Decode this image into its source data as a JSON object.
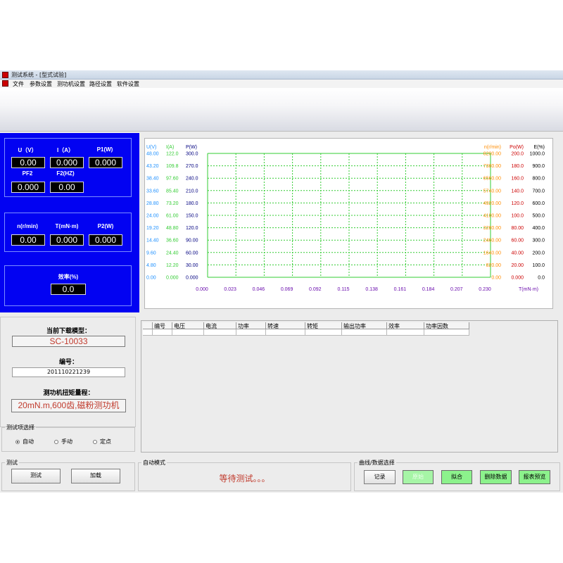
{
  "window": {
    "title": "测试系统 - [型式试验]",
    "menu": [
      "文件",
      "参数设置",
      "测功机设置",
      "路径设置",
      "软件设置"
    ]
  },
  "readings": {
    "u_label": "U（V）",
    "u_value": "0.00",
    "i_label": "I（A）",
    "i_value": "0.000",
    "p1_label": "P1(W)",
    "p1_value": "0.000",
    "pf2_label": "PF2",
    "pf2_value": "0.000",
    "f2_label": "F2(HZ)",
    "f2_value": "0.00",
    "n_label": "n(r/min)",
    "n_value": "0.00",
    "t_label": "T(mN·m)",
    "t_value": "0.000",
    "p2_label": "P2(W)",
    "p2_value": "0.000",
    "eff_label": "效率(%)",
    "eff_value": "0.0"
  },
  "chart_data": {
    "type": "line",
    "x": [],
    "series": [],
    "xlabel": "T(mN·m)",
    "x_ticks": [
      "0.000",
      "0.023",
      "0.046",
      "0.069",
      "0.092",
      "0.115",
      "0.138",
      "0.161",
      "0.184",
      "0.207",
      "0.230"
    ],
    "xlim": [
      0,
      0.23
    ],
    "grid": true,
    "colors": {
      "u": "#1e90ff",
      "i": "#33cc33",
      "p": "#000080",
      "n": "#ff8c00",
      "po": "#cc0000",
      "eff": "#000000",
      "grid": "#33cc33"
    },
    "left_axes": [
      {
        "label": "U(V)",
        "color": "#1e90ff",
        "ylim": [
          0,
          48
        ],
        "ticks": [
          "0.00",
          "4.80",
          "9.60",
          "14.40",
          "19.20",
          "24.00",
          "28.80",
          "33.60",
          "38.40",
          "43.20",
          "48.00"
        ]
      },
      {
        "label": "I(A)",
        "color": "#33cc33",
        "ylim": [
          0,
          122
        ],
        "ticks": [
          "0.000",
          "12.20",
          "24.40",
          "36.60",
          "48.80",
          "61.00",
          "73.20",
          "85.40",
          "97.60",
          "109.8",
          "122.0"
        ]
      },
      {
        "label": "P(W)",
        "color": "#000080",
        "ylim": [
          0,
          300
        ],
        "ticks": [
          "0.000",
          "30.00",
          "60.00",
          "90.00",
          "120.0",
          "150.0",
          "180.0",
          "210.0",
          "240.0",
          "270.0",
          "300.0"
        ]
      }
    ],
    "right_axes": [
      {
        "label": "n(r/min)",
        "color": "#ff8c00",
        "ylim": [
          0,
          8200
        ],
        "ticks": [
          "0.00",
          "820.00",
          "1640.00",
          "2460.00",
          "3280.00",
          "4100.00",
          "4920.00",
          "5740.00",
          "6560.00",
          "7380.00",
          "8200.00"
        ]
      },
      {
        "label": "Po(W)",
        "color": "#cc0000",
        "ylim": [
          0,
          200
        ],
        "ticks": [
          "0.000",
          "20.00",
          "40.00",
          "60.00",
          "80.00",
          "100.0",
          "120.0",
          "140.0",
          "160.0",
          "180.0",
          "200.0"
        ]
      },
      {
        "label": "E(%)",
        "color": "#000000",
        "ylim": [
          0,
          1000
        ],
        "ticks": [
          "0.0",
          "100.0",
          "200.0",
          "300.0",
          "400.0",
          "500.0",
          "600.0",
          "700.0",
          "800.0",
          "900.0",
          "1000.0"
        ]
      }
    ]
  },
  "model": {
    "current_label": "当前下载模型：",
    "current_value": "SC-10033",
    "id_label": "编号：",
    "id_value": "201110221239",
    "range_label": "测功机扭矩量程：",
    "range_value": "20mN.m,600齿,磁粉测功机"
  },
  "test_item": {
    "legend": "测试项选择",
    "options": [
      {
        "label": "自动",
        "selected": true
      },
      {
        "label": "手动",
        "selected": false
      },
      {
        "label": "定点",
        "selected": false
      }
    ]
  },
  "test": {
    "legend": "测试",
    "test_button": "测试",
    "load_button": "加载"
  },
  "auto_mode": {
    "legend": "自动模式",
    "status": "等待测试。。。"
  },
  "curve": {
    "legend": "曲线/数据选择",
    "record_button": "记录",
    "original_button": "原始",
    "fit_button": "拟合",
    "delete_button": "删除数据",
    "report_button": "报表预览"
  },
  "table": {
    "columns": [
      "编号",
      "电压",
      "电流",
      "功率",
      "转速",
      "转矩",
      "输出功率",
      "效率",
      "功率因数"
    ]
  }
}
